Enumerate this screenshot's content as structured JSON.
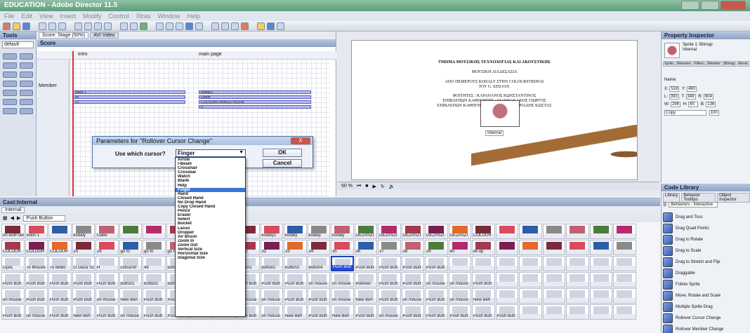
{
  "window": {
    "title": "EDUCATION - Adobe Director 11.5"
  },
  "menu": [
    "File",
    "Edit",
    "View",
    "Insert",
    "Modify",
    "Control",
    "Xtras",
    "Window",
    "Help"
  ],
  "tools": {
    "title": "Tools",
    "preset": "default"
  },
  "score": {
    "tabs": [
      "Score: Stage (50%)",
      "AVI Video"
    ],
    "panel_title": "Score",
    "markers": {
      "intro": "intro",
      "main": "main page"
    },
    "member_label": "Member",
    "sprites_left": [
      "violin 1",
      "xx",
      "21"
    ],
    "sprites_right": [
      "kodaly1",
      "Orient",
      "COLOURSTRINGS VIOLIN",
      "0"
    ]
  },
  "dialog": {
    "title": "Parameters for \"Rollover Cursor Change\"",
    "question": "Use which cursor?",
    "selected": "Finger",
    "ok": "OK",
    "cancel": "Cancel",
    "close": "X",
    "options": [
      "Arrow",
      "I-Beam",
      "Crosshair",
      "Crossbar",
      "Watch",
      "Blank",
      "Help",
      "Finger",
      "Hand",
      "Closed Hand",
      "No Drop Hand",
      "Copy Closed Hand",
      "Pencil",
      "Eraser",
      "Select",
      "Bucket",
      "Lasso",
      "Dropper",
      "Air Brush",
      "Zoom In",
      "Zoom Out",
      "Vertical Size",
      "Horizontal Size",
      "Diagonal Size"
    ]
  },
  "stage": {
    "lines": [
      "ΤΜΗΜΑ ΜΟΥΣΙΚΗΣ ΤΕΧΝΟΛΟΓΙΑΣ ΚΑΙ ΑΚΟΥΣΤΙΚΗΣ",
      "ΜΟΥΣΙΚΗ ΑΙΑΔΕΣΑΣΙΑ",
      "ΑΠΟ ΠΕΜΕΡΟΥΣ ΚΟDALY ΣΤΗΝ COLOURSTRINGS",
      "ΤΟΥ G. SZILVAY.",
      "ΦΟΙΤΗΤΕΣ : ΚΑΡΑΝΑΝΟΣ ΚΩΝΣΤΑΝΤΙΝΟΣ",
      "ΕΠΙΒΛΕΠΩΝ ΚΑΘΗΓΗΤΗΣ : ΓΙΑΝΝΑΚΑΚΗΣ ΓΙΩΡΓΟΣ",
      "ΕΠΙΒΛΕΠΩΝ ΚΑΘΗΓΗΤΗΣ : ΠΑΠΑΔΗΜΗΤΡΙΑΔΗΣ ΚΩΣΤΑΣ"
    ],
    "tooltip": "Internal",
    "zoom": "50 %"
  },
  "property_inspector": {
    "title": "Property Inspector",
    "type": "Sprite 1: Bitmap",
    "cast": "Internal",
    "tabs": [
      "Sprite",
      "Behavior",
      "Filters",
      "Member",
      "Bitmap",
      "Movie"
    ],
    "name_label": "Name:",
    "fields": {
      "x": "518",
      "y": "480",
      "l": "393",
      "t": "349",
      "r": "604",
      "b": "136",
      "w": "296",
      "h": "85"
    },
    "ink": "Copy",
    "blend": "100"
  },
  "cast": {
    "title": "Cast:Internal",
    "tab": "Internal",
    "member_name": "Push Button",
    "rows": [
      [
        "on exitFrame me GO T",
        "violin 1",
        "",
        "kodaly",
        "Gabe",
        "",
        "",
        "",
        "",
        "",
        "18",
        "kodaly1",
        "kodaly",
        "kodaly",
        "kodaly",
        "GEZASZI",
        "GEZASZI",
        "GEZASZI",
        "GEZASZI",
        "GEZASZI",
        "COLOUR",
        "",
        "",
        "",
        "",
        "",
        ""
      ],
      [
        "COLOUR",
        "COLOUR",
        "COLOUR",
        "25",
        "26",
        "go to",
        "go to",
        "go to",
        "go to",
        "go to",
        "go to",
        "32",
        "33",
        "34",
        "35",
        "36",
        "37",
        "38",
        "39",
        "40",
        "Bt-up",
        "",
        "",
        "",
        "",
        "",
        ""
      ],
      [
        "Ορος",
        "To Mousik",
        "To Biblio",
        "Ο Geza Szilvay",
        "H",
        "colourstr",
        "49",
        "button1",
        "button1",
        "kodalyme",
        "button1",
        "button2",
        "button3",
        "button4",
        "Push Butt",
        "Push Butt",
        "Push Butt",
        "Push Butt",
        "Push Butt",
        "",
        "",
        "",
        "",
        "",
        "",
        "",
        ""
      ],
      [
        "Push Butt",
        "Push Butt",
        "Push Butt",
        "Push Butt",
        "Push Butt",
        "button1",
        "button2",
        "button3",
        "BUTTON",
        "BACK TO",
        "Push Butt",
        "Push Butt",
        "Push Butt",
        "on mouse",
        "on mouse",
        "Rollover",
        "Push Butt",
        "Push Butt",
        "on mouse",
        "on mouse",
        "Push Butt",
        "",
        "",
        "",
        "",
        "",
        ""
      ],
      [
        "on mouse",
        "Push Butt",
        "Push Butt",
        "Push Butt",
        "on mouse",
        "New Beh",
        "Push Butt",
        "Push Butt",
        "on mouse",
        "Push Butt",
        "on mouse",
        "on mouse",
        "Push Butt",
        "Push Butt",
        "on mouse",
        "New Beh",
        "Push Butt",
        "on mouse",
        "Push Butt",
        "on mouse",
        "New Beh",
        "",
        "",
        "",
        "",
        "",
        ""
      ],
      [
        "Push Butt",
        "on mouse",
        "Push Butt",
        "New Beh",
        "Push Butt",
        "on mouse",
        "Push Butt",
        "Push Butt",
        "New Beh",
        "Push Butt",
        "Push Butt",
        "on mouse",
        "New Beh",
        "Push Butt",
        "New Beh",
        "Push Butt",
        "on mouse",
        "Push Butt",
        "Push Butt",
        "Push Butt",
        "Push Butt",
        "Push Butt",
        "",
        "",
        "",
        "",
        ""
      ]
    ]
  },
  "code_library": {
    "title": "Code Library",
    "tabs": [
      "Library",
      "Behavior Tooltips",
      "Object Inspector"
    ],
    "category": "Behaviors - Interactive",
    "items": [
      "Drag and Toss",
      "Drag Quad Points",
      "Drag to Rotate",
      "Drag to Scale",
      "Drag to Stretch and Flip",
      "Draggable",
      "Follow Sprite",
      "Move, Rotate and Scale",
      "Multiple Sprite Drag",
      "Rollover Cursor Change",
      "Rollover Member Change"
    ]
  }
}
